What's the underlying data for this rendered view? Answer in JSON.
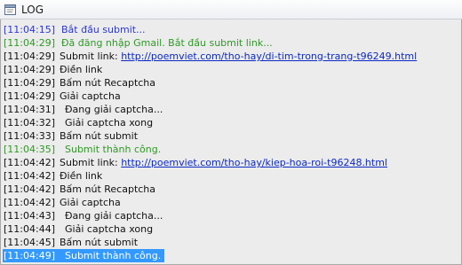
{
  "window": {
    "title": "LOG",
    "icon": "window-icon"
  },
  "colors": {
    "info": "#2a35d6",
    "success": "#2d9a24",
    "normal": "#111111",
    "link": "#0b29c4",
    "selection": "#3399ff"
  },
  "log": [
    {
      "time": "[11:04:15]",
      "text": "Bắt đầu submit...",
      "level": "info",
      "indent": 0
    },
    {
      "time": "[11:04:29]",
      "text": "Đã đăng nhập Gmail. Bắt đầu submit link...",
      "level": "success",
      "indent": 0
    },
    {
      "time": "[11:04:29]",
      "text": "Submit link:",
      "link": "http://poemviet.com/tho-hay/di-tim-trong-trang-t96249.html",
      "level": "normal",
      "indent": 1
    },
    {
      "time": "[11:04:29]",
      "text": "Điền link",
      "level": "normal",
      "indent": 1
    },
    {
      "time": "[11:04:29]",
      "text": "Bấm nút Recaptcha",
      "level": "normal",
      "indent": 1
    },
    {
      "time": "[11:04:29]",
      "text": "Giải captcha",
      "level": "normal",
      "indent": 1
    },
    {
      "time": "[11:04:31]",
      "text": "Đang giải captcha...",
      "level": "normal",
      "indent": 2
    },
    {
      "time": "[11:04:32]",
      "text": "Giải captcha xong",
      "level": "normal",
      "indent": 2
    },
    {
      "time": "[11:04:33]",
      "text": "Bấm nút submit",
      "level": "normal",
      "indent": 1
    },
    {
      "time": "[11:04:35]",
      "text": "Submit thành công.",
      "level": "success",
      "indent": 2
    },
    {
      "time": "[11:04:42]",
      "text": "Submit link:",
      "link": "http://poemviet.com/tho-hay/kiep-hoa-roi-t96248.html",
      "level": "normal",
      "indent": 1
    },
    {
      "time": "[11:04:42]",
      "text": "Điền link",
      "level": "normal",
      "indent": 1
    },
    {
      "time": "[11:04:42]",
      "text": "Bấm nút Recaptcha",
      "level": "normal",
      "indent": 1
    },
    {
      "time": "[11:04:42]",
      "text": "Giải captcha",
      "level": "normal",
      "indent": 1
    },
    {
      "time": "[11:04:43]",
      "text": "Đang giải captcha...",
      "level": "normal",
      "indent": 2
    },
    {
      "time": "[11:04:44]",
      "text": "Giải captcha xong",
      "level": "normal",
      "indent": 2
    },
    {
      "time": "[11:04:45]",
      "text": "Bấm nút submit",
      "level": "normal",
      "indent": 1
    },
    {
      "time": "[11:04:49]",
      "text": "Submit thành công.",
      "level": "success",
      "indent": 2,
      "selected": true
    }
  ]
}
